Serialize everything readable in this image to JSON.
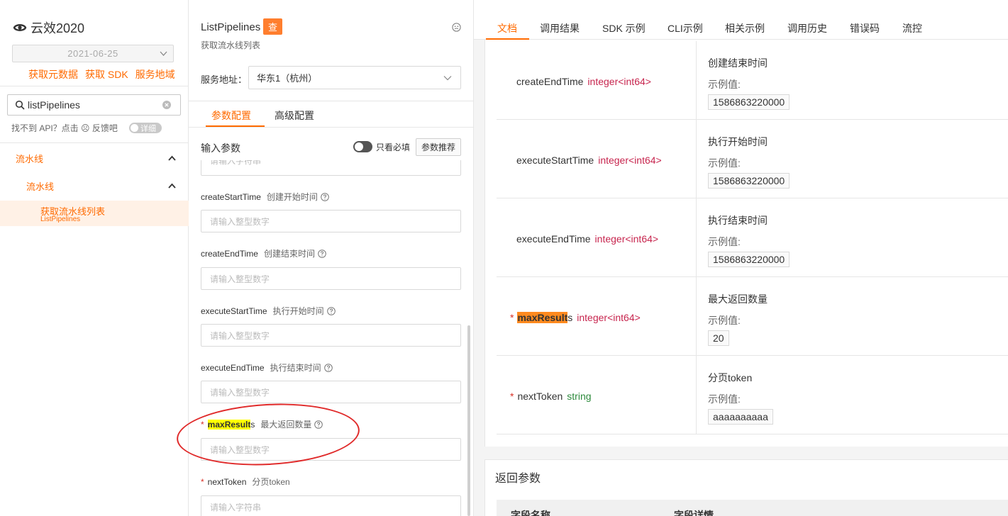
{
  "sidebar": {
    "brand": "云效2020",
    "version": "2021-06-25",
    "links": [
      "获取元数据",
      "获取 SDK",
      "服务地域"
    ],
    "search_value": "listPipelines",
    "feedback": "找不到 API？点击 ☹ 反馈吧",
    "detail_toggle": "详细",
    "tree_l1": "流水线",
    "tree_l2": "流水线",
    "active_item": "获取流水线列表",
    "active_item_sub": "ListPipelines"
  },
  "form": {
    "api_name": "ListPipelines",
    "api_badge": "查",
    "api_desc": "获取流水线列表",
    "service_label": "服务地址：",
    "service_value": "华东1（杭州）",
    "tabs": [
      "参数配置",
      "高级配置"
    ],
    "input_title": "输入参数",
    "required_only": "只看必填",
    "recommend_btn": "参数推荐",
    "cut_placeholder": "请输入字符串",
    "params": [
      {
        "name": "createStartTime",
        "desc": "创建开始时间",
        "placeholder": "请输入整型数字"
      },
      {
        "name": "createEndTime",
        "desc": "创建结束时间",
        "placeholder": "请输入整型数字"
      },
      {
        "name": "executeStartTime",
        "desc": "执行开始时间",
        "placeholder": "请输入整型数字"
      },
      {
        "name": "executeEndTime",
        "desc": "执行结束时间",
        "placeholder": "请输入整型数字"
      },
      {
        "name_hl": "maxResult",
        "name_rest": "s",
        "desc": "最大返回数量",
        "placeholder": "请输入整型数字",
        "required": true
      },
      {
        "name": "nextToken",
        "desc": "分页token",
        "placeholder": "请输入字符串",
        "required": true
      }
    ]
  },
  "docs": {
    "tabs": [
      "文档",
      "调用结果",
      "SDK 示例",
      "CLI示例",
      "相关示例",
      "调用历史",
      "错误码",
      "流控"
    ],
    "example_label": "示例值:",
    "rows": [
      {
        "name": "createEndTime",
        "type": "integer<int64>",
        "desc": "创建结束时间",
        "example": "1586863220000"
      },
      {
        "name": "executeStartTime",
        "type": "integer<int64>",
        "desc": "执行开始时间",
        "example": "1586863220000"
      },
      {
        "name": "executeEndTime",
        "type": "integer<int64>",
        "desc": "执行结束时间",
        "example": "1586863220000"
      },
      {
        "name_hl": "maxResult",
        "name_rest": "s",
        "type": "integer<int64>",
        "desc": "最大返回数量",
        "example": "20",
        "required": true
      },
      {
        "name": "nextToken",
        "type": "string",
        "desc": "分页token",
        "example": "aaaaaaaaaa",
        "required": true
      }
    ],
    "return_title": "返回参数",
    "return_cols": [
      "字段名称",
      "字段详情"
    ]
  }
}
